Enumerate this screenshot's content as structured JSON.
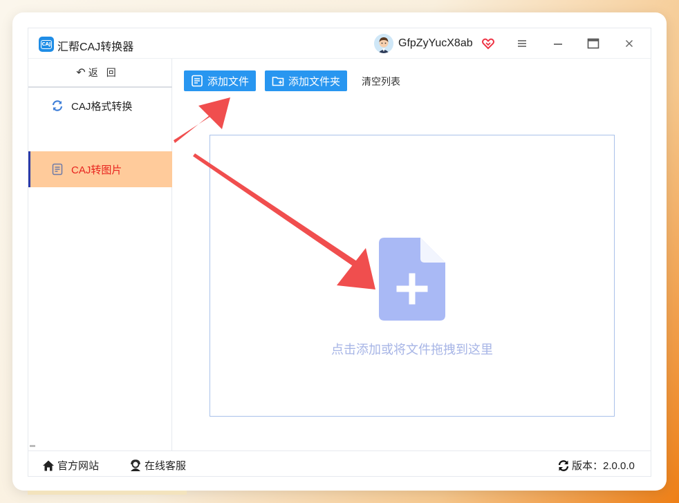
{
  "app": {
    "title": "汇帮CAJ转换器",
    "logo_text": "CAJ"
  },
  "user": {
    "name": "GfpZyYucX8ab"
  },
  "window_controls": [
    "menu-icon",
    "minimize-icon",
    "maximize-icon",
    "close-icon"
  ],
  "sidebar": {
    "back_label": "返回",
    "back_arrow": "↶",
    "items": [
      {
        "label": "CAJ格式转换",
        "icon": "refresh-icon",
        "active": false
      },
      {
        "label": "CAJ转图片",
        "icon": "document-icon",
        "active": true
      }
    ]
  },
  "toolbar": {
    "add_file_label": "添加文件",
    "add_folder_label": "添加文件夹",
    "clear_list_label": "清空列表"
  },
  "dropzone": {
    "hint": "点击添加或将文件拖拽到这里"
  },
  "footer": {
    "website_label": "官方网站",
    "support_label": "在线客服",
    "version_label": "版本：2.0.0.0"
  },
  "colors": {
    "accent_blue": "#2896f0",
    "active_item_bg": "#ffcb9b",
    "active_item_text": "#e8231e",
    "arrow_red": "#f04e4e",
    "doc_icon": "#a9b9f5",
    "dropzone_border": "#a9c1ea"
  }
}
